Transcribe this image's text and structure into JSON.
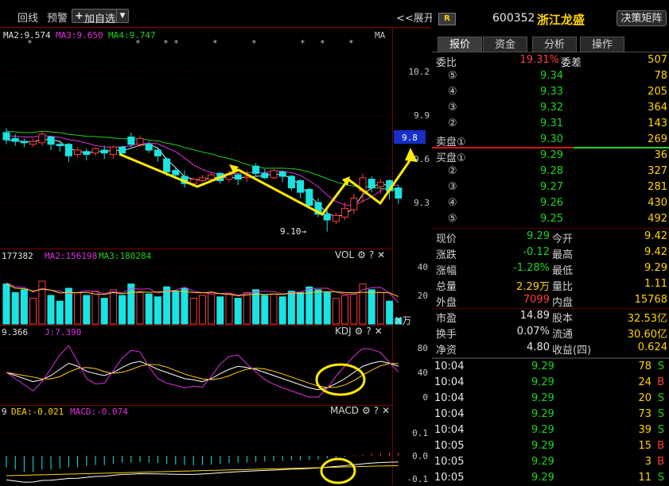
{
  "toolbar": {
    "tab_intraday": "回线",
    "tab_alert": "预警",
    "add_watch": "加自选",
    "plus": "+",
    "dropdown_arrow": "▼",
    "expand": "<<展开"
  },
  "main_chart": {
    "ma_labels": [
      "MA2:9.574",
      "MA3:9.650",
      "MA4:9.747"
    ],
    "ma_tag": "MA",
    "y_ticks": [
      "10.2",
      "9.9",
      "9.6",
      "9.3"
    ],
    "current_price_tag": "9.8",
    "low_annotation": "9.10→",
    "star_marks": [
      "*",
      "*",
      "*",
      "*",
      "*",
      "*",
      "*",
      "*",
      "*"
    ],
    "colors": {
      "ma2": "#e0e0e0",
      "ma3": "#e030e0",
      "ma4": "#20d020",
      "rise": "#ff3b3b",
      "fall": "#19e3e3",
      "annotation": "#ffea00"
    }
  },
  "volume_panel": {
    "labels": [
      "177382",
      "MA2:156198",
      "MA3:180284"
    ],
    "name": "VOL",
    "y_ticks": [
      "40",
      "20"
    ],
    "unit": "X万"
  },
  "kdj_panel": {
    "labels": [
      "9.366",
      "J:7.390"
    ],
    "name": "KDJ",
    "y_ticks": [
      "80",
      "40",
      "0"
    ]
  },
  "macd_panel": {
    "labels": [
      "9",
      "DEA:-0.021",
      "MACD:-0.074"
    ],
    "name": "MACD",
    "y_ticks": [
      "0.1",
      "0.0",
      "-0.1"
    ]
  },
  "panel_icons": {
    "settings": "⚙",
    "help": "?",
    "close": "✕"
  },
  "quote": {
    "badge": "R",
    "code": "600352",
    "name": "浙江龙盛",
    "decision_btn": "决策矩阵",
    "tabs": [
      "报价",
      "资金",
      "分析",
      "操作"
    ],
    "weibi_label": "委比",
    "weibi_value": "19.31%",
    "weicha_label": "委差",
    "weicha_value": "507",
    "asks": [
      {
        "label": "⑤",
        "price": "9.34",
        "vol": "78"
      },
      {
        "label": "④",
        "price": "9.33",
        "vol": "205"
      },
      {
        "label": "③",
        "price": "9.32",
        "vol": "364"
      },
      {
        "label": "②",
        "price": "9.31",
        "vol": "143"
      },
      {
        "label": "卖盘①",
        "price": "9.30",
        "vol": "269"
      }
    ],
    "bids": [
      {
        "label": "买盘①",
        "price": "9.29",
        "vol": "36"
      },
      {
        "label": "②",
        "price": "9.28",
        "vol": "327"
      },
      {
        "label": "③",
        "price": "9.27",
        "vol": "281"
      },
      {
        "label": "④",
        "price": "9.26",
        "vol": "430"
      },
      {
        "label": "⑤",
        "price": "9.25",
        "vol": "492"
      }
    ],
    "stats": [
      {
        "l1": "现价",
        "v1": "9.29",
        "c1": "green",
        "l2": "今开",
        "v2": "9.42",
        "c2": "red"
      },
      {
        "l1": "涨跌",
        "v1": "-0.12",
        "c1": "green",
        "l2": "最高",
        "v2": "9.42",
        "c2": "red"
      },
      {
        "l1": "涨幅",
        "v1": "-1.28%",
        "c1": "green",
        "l2": "最低",
        "v2": "9.29",
        "c2": "green"
      },
      {
        "l1": "总量",
        "v1": "2.29万",
        "c1": "yellow",
        "l2": "量比",
        "v2": "1.11",
        "c2": "white"
      },
      {
        "l1": "外盘",
        "v1": "7099",
        "c1": "red",
        "l2": "内盘",
        "v2": "15768",
        "c2": "green"
      }
    ],
    "stats2": [
      {
        "l1": "市盈",
        "v1": "14.89",
        "l2": "股本",
        "v2": "32.53亿"
      },
      {
        "l1": "换手",
        "v1": "0.07%",
        "l2": "流通",
        "v2": "30.60亿"
      },
      {
        "l1": "净资",
        "v1": "4.80",
        "l2": "收益(四)",
        "v2": "0.624"
      }
    ],
    "trades": [
      {
        "time": "10:04",
        "price": "9.29",
        "vol": "78",
        "side": "S"
      },
      {
        "time": "10:04",
        "price": "9.29",
        "vol": "24",
        "side": "B"
      },
      {
        "time": "10:04",
        "price": "9.29",
        "vol": "20",
        "side": "S"
      },
      {
        "time": "10:04",
        "price": "9.29",
        "vol": "73",
        "side": "S"
      },
      {
        "time": "10:04",
        "price": "9.29",
        "vol": "39",
        "side": "S"
      },
      {
        "time": "10:05",
        "price": "9.29",
        "vol": "15",
        "side": "B"
      },
      {
        "time": "10:05",
        "price": "9.29",
        "vol": "3",
        "side": "B"
      },
      {
        "time": "10:05",
        "price": "9.29",
        "vol": "11",
        "side": "S"
      }
    ]
  }
}
